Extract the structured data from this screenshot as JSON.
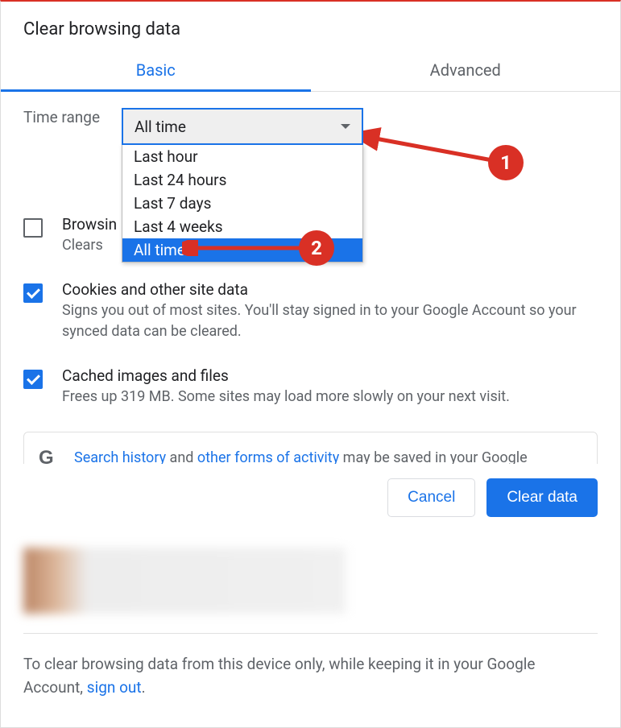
{
  "title": "Clear browsing data",
  "tabs": {
    "basic": "Basic",
    "advanced": "Advanced"
  },
  "time_range": {
    "label": "Time range",
    "selected": "All time",
    "options": [
      "Last hour",
      "Last 24 hours",
      "Last 7 days",
      "Last 4 weeks",
      "All time"
    ]
  },
  "items": {
    "browsing": {
      "title": "Browsin",
      "desc": "Clears "
    },
    "cookies": {
      "title": "Cookies and other site data",
      "desc": "Signs you out of most sites. You'll stay signed in to your Google Account so your synced data can be cleared."
    },
    "cache": {
      "title": "Cached images and files",
      "desc": "Frees up 319 MB. Some sites may load more slowly on your next visit."
    }
  },
  "info": {
    "p1": "Search history",
    "p2": " and ",
    "p3": "other forms of activity",
    "p4": " may be saved in your Google Account when you're signed in. You can delete them anytime."
  },
  "buttons": {
    "cancel": "Cancel",
    "clear": "Clear data"
  },
  "bottom": {
    "t1": "To clear browsing data from this device only, while keeping it in your Google Account, ",
    "link": "sign out",
    "t2": "."
  },
  "annotations": {
    "a1": "1",
    "a2": "2"
  }
}
